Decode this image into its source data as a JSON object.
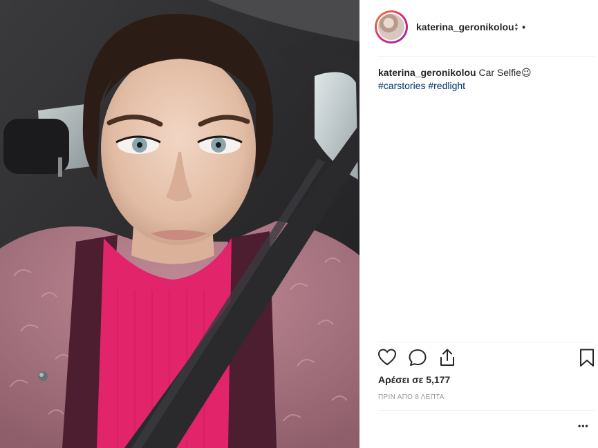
{
  "post": {
    "header": {
      "username": "katerina_geronikolou",
      "separator": "•"
    },
    "caption": {
      "username": "katerina_geronikolou",
      "text": "Car Selfie😉",
      "hashtags": [
        "#carstories",
        "#redlight"
      ]
    },
    "actions": {
      "like_icon": "heart-icon",
      "comment_icon": "comment-icon",
      "share_icon": "share-icon",
      "save_icon": "bookmark-icon"
    },
    "likes_text": "Αρέσει σε 5,177",
    "timestamp": "ΠΡΙΝ ΑΠΟ 8 ΛΕΠΤΑ",
    "more_label": "•••"
  },
  "colors": {
    "text": "#262626",
    "hashtag": "#003569",
    "muted": "#999999",
    "divider": "#efefef"
  }
}
